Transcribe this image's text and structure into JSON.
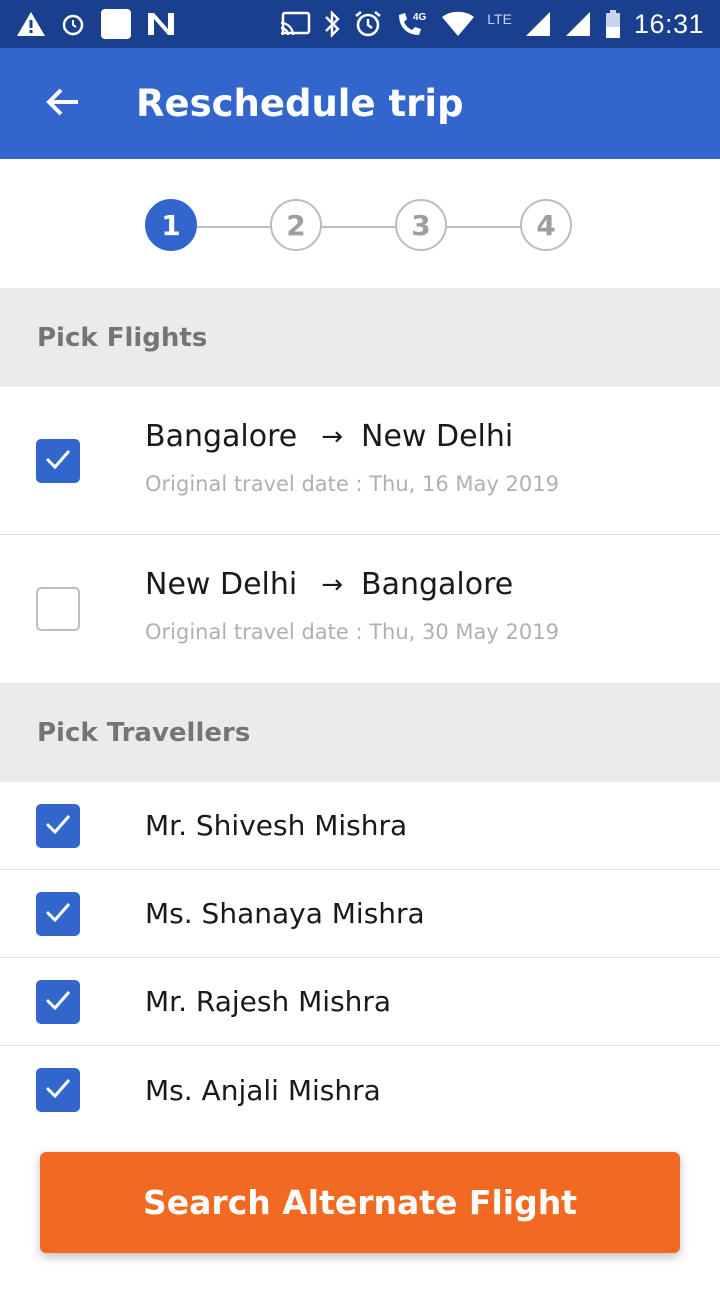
{
  "status_bar": {
    "time": "16:31",
    "network_label": "LTE",
    "icons": [
      "warning-icon",
      "alarm-icon",
      "notification-square-icon",
      "n-app-icon",
      "cast-icon",
      "bluetooth-icon",
      "alarm-clock-icon",
      "volte-call-icon",
      "wifi-icon",
      "signal-icon",
      "signal-icon",
      "battery-icon"
    ]
  },
  "app_bar": {
    "title": "Reschedule trip",
    "back_icon": "arrow-left-icon",
    "color": "#3366cc"
  },
  "stepper": {
    "steps": [
      "1",
      "2",
      "3",
      "4"
    ],
    "active_step": "1"
  },
  "flights_section": {
    "title": "Pick Flights",
    "flights": [
      {
        "from": "Bangalore",
        "to": "New Delhi",
        "date_text": "Original travel date : Thu, 16 May 2019",
        "checked": true
      },
      {
        "from": "New Delhi",
        "to": "Bangalore",
        "date_text": "Original travel date : Thu, 30 May 2019",
        "checked": false
      }
    ]
  },
  "travellers_section": {
    "title": "Pick Travellers",
    "travellers": [
      {
        "name": "Mr. Shivesh Mishra",
        "checked": true
      },
      {
        "name": "Ms. Shanaya Mishra",
        "checked": true
      },
      {
        "name": "Mr. Rajesh Mishra",
        "checked": true
      },
      {
        "name": "Ms. Anjali Mishra",
        "checked": true
      }
    ]
  },
  "action": {
    "search_label": "Search Alternate Flight",
    "color": "#f26a21"
  }
}
